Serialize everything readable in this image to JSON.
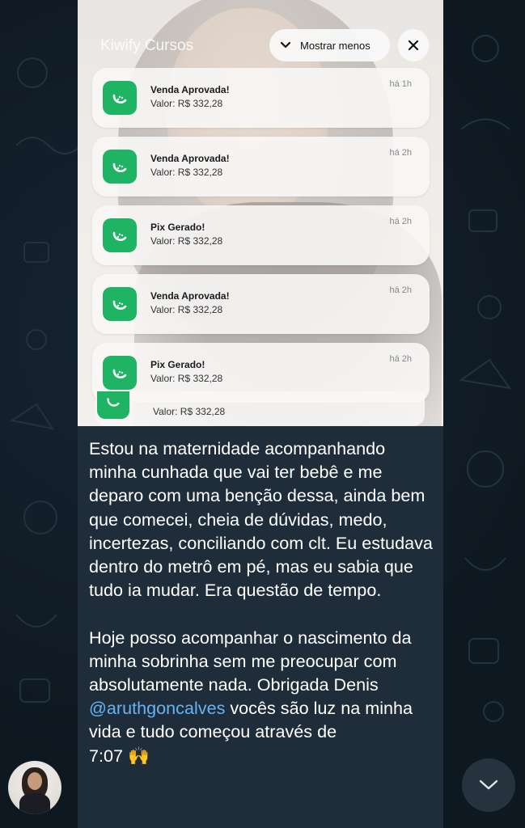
{
  "notification_center": {
    "app_name": "Kiwify Cursos",
    "show_less_label": "Mostrar menos",
    "close_icon": "close-icon",
    "accent_color": "#1fb364",
    "notifications": [
      {
        "title": "Venda Aprovada!",
        "value": "Valor: R$ 332,28",
        "time": "há 1h"
      },
      {
        "title": "Venda Aprovada!",
        "value": "Valor: R$ 332,28",
        "time": "há 2h"
      },
      {
        "title": "Pix Gerado!",
        "value": "Valor: R$ 332,28",
        "time": "há 2h"
      },
      {
        "title": "Venda Aprovada!",
        "value": "Valor: R$ 332,28",
        "time": "há 2h"
      },
      {
        "title": "Pix Gerado!",
        "value": "Valor: R$ 332,28",
        "time": "há 2h"
      }
    ],
    "peek_value": "Valor: R$ 332,28"
  },
  "message": {
    "paragraph1": "Estou na maternidade acompanhando minha cunhada que vai ter bebê e me deparo com uma benção dessa, ainda bem que comecei, cheia de dúvidas, medo, incertezas, conciliando com clt. Eu estudava dentro do metrô em pé, mas eu sabia que tudo ia mudar. Era questão de tempo.",
    "paragraph2_before": "Hoje posso acompanhar o nascimento da minha sobrinha sem me preocupar com absolutamente nada. Obrigada Denis ",
    "mention": "@aruthgoncalves",
    "paragraph2_after": " vocês são luz na minha vida e tudo começou através de",
    "time": "7:07",
    "emoji": "🙌"
  },
  "icons": {
    "scroll_down": "chevron-down-icon",
    "avatar": "avatar"
  }
}
